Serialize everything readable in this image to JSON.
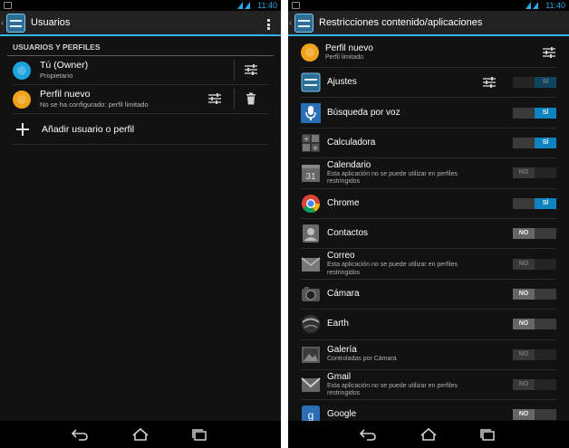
{
  "status": {
    "time": "11:40"
  },
  "left": {
    "title": "Usuarios",
    "section_header": "USUARIOS Y PERFILES",
    "users": [
      {
        "name": "Tú (Owner)",
        "subtitle": "Propietario",
        "color": "#1ea2de",
        "icon": "avatar-icon"
      },
      {
        "name": "Perfil nuevo",
        "subtitle": "No se ha configurado: perfil limitado",
        "color": "#f0a21a",
        "icon": "avatar-icon"
      }
    ],
    "add_label": "Añadir usuario o perfil"
  },
  "right": {
    "title": "Restricciones contenido/aplicaciones",
    "profile": {
      "name": "Perfil nuevo",
      "subtitle": "Perfil limitado"
    },
    "apps": [
      {
        "name": "Ajustes",
        "subtitle": "",
        "toggle": "SÍ",
        "state": "disabled-on",
        "icon": "settings-icon",
        "has_settings": true
      },
      {
        "name": "Búsqueda por voz",
        "subtitle": "",
        "toggle": "SÍ",
        "state": "on",
        "icon": "microphone-icon"
      },
      {
        "name": "Calculadora",
        "subtitle": "",
        "toggle": "SÍ",
        "state": "on",
        "icon": "calculator-icon"
      },
      {
        "name": "Calendario",
        "subtitle": "Esta aplicación no se puede utilizar en perfiles restringidos",
        "toggle": "NO",
        "state": "disabled-off",
        "icon": "calendar-icon",
        "icon_text": "31"
      },
      {
        "name": "Chrome",
        "subtitle": "",
        "toggle": "SÍ",
        "state": "on",
        "icon": "chrome-icon"
      },
      {
        "name": "Contactos",
        "subtitle": "",
        "toggle": "NO",
        "state": "off",
        "icon": "contacts-icon"
      },
      {
        "name": "Correo",
        "subtitle": "Esta aplicación no se puede utilizar en perfiles restringidos",
        "toggle": "NO",
        "state": "disabled-off",
        "icon": "email-icon"
      },
      {
        "name": "Cámara",
        "subtitle": "",
        "toggle": "NO",
        "state": "off",
        "icon": "camera-icon"
      },
      {
        "name": "Earth",
        "subtitle": "",
        "toggle": "NO",
        "state": "off",
        "icon": "earth-icon"
      },
      {
        "name": "Galería",
        "subtitle": "Controladas por Cámara",
        "toggle": "NO",
        "state": "disabled-off",
        "icon": "gallery-icon"
      },
      {
        "name": "Gmail",
        "subtitle": "Esta aplicación no se puede utilizar en perfiles restringidos",
        "toggle": "NO",
        "state": "disabled-off",
        "icon": "gmail-icon"
      },
      {
        "name": "Google",
        "subtitle": "",
        "toggle": "NO",
        "state": "off",
        "icon": "google-icon"
      }
    ]
  },
  "colors": {
    "accent": "#33b5e5",
    "toggle_on": "#0f83c0",
    "background": "#121212"
  }
}
